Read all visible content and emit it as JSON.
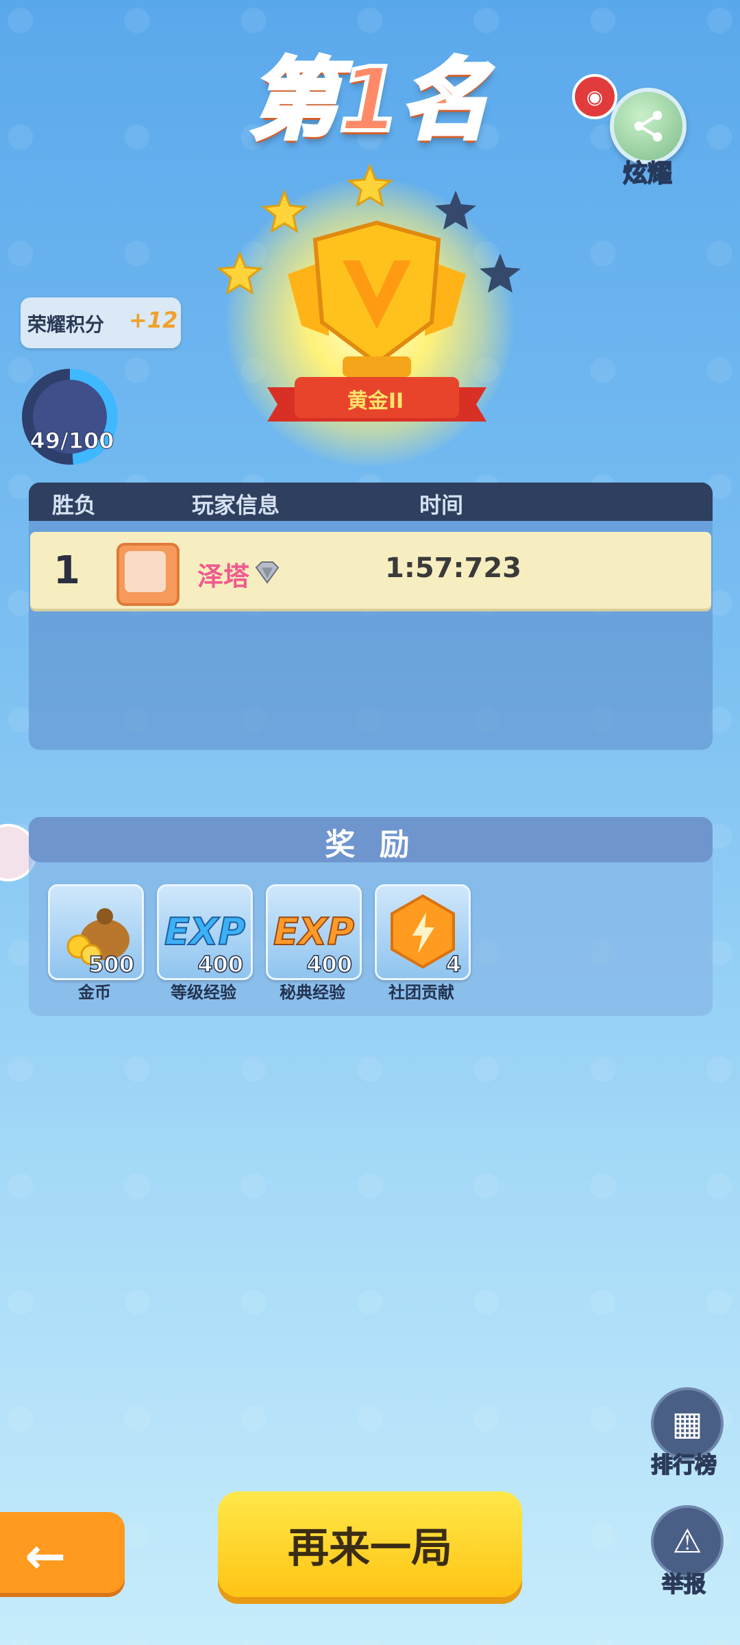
{
  "header": {
    "rank_title": "第1名",
    "share_label": "炫耀"
  },
  "trophy": {
    "badge_label": "黄金II",
    "stars_filled": 3,
    "stars_total": 5
  },
  "honor": {
    "label": "荣耀积分",
    "gain": "+12",
    "progress_text": "49/100",
    "progress_fraction": 0.49
  },
  "table": {
    "headers": [
      "胜负",
      "玩家信息",
      "时间"
    ],
    "rows": [
      {
        "rank": "1",
        "player": "泽塔",
        "time": "1:57:723"
      }
    ]
  },
  "rewards": {
    "title": "奖 励",
    "items": [
      {
        "name": "金币",
        "qty": "500",
        "icon": "gold-coin-bag-icon"
      },
      {
        "name": "等级经验",
        "qty": "400",
        "icon": "exp-blue-icon",
        "icon_text": "EXP"
      },
      {
        "name": "秘典经验",
        "qty": "400",
        "icon": "exp-orange-icon",
        "icon_text": "EXP"
      },
      {
        "name": "社团贡献",
        "qty": "4",
        "icon": "club-contribution-icon"
      }
    ]
  },
  "buttons": {
    "play_again": "再来一局",
    "leaderboard": "排行榜",
    "report": "举报"
  },
  "colors": {
    "accent_orange": "#ff9a1e",
    "play_again_yellow": "#ffd21e",
    "player_name_pink": "#f05a8e"
  }
}
